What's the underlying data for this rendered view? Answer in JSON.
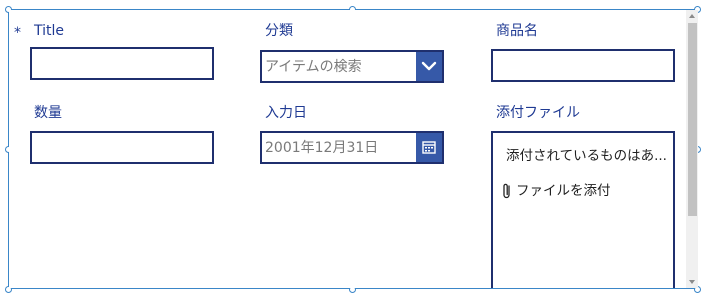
{
  "form": {
    "required_marker": "*",
    "fields": {
      "title": {
        "label": "Title",
        "value": ""
      },
      "category": {
        "label": "分類",
        "placeholder": "アイテムの検索",
        "dropdown_icon": "chevron-down-icon"
      },
      "product_name": {
        "label": "商品名",
        "value": ""
      },
      "quantity": {
        "label": "数量",
        "value": ""
      },
      "input_date": {
        "label": "入力日",
        "placeholder": "2001年12月31日",
        "picker_icon": "calendar-icon"
      },
      "attachments": {
        "label": "添付ファイル",
        "existing_text": "添付されているものはあ...",
        "add_label": "ファイルを添付",
        "add_icon": "paperclip-icon"
      }
    }
  },
  "colors": {
    "label": "#1f3a93",
    "border": "#1f2f6e",
    "button": "#3659a8",
    "selection": "#3a86c8"
  }
}
